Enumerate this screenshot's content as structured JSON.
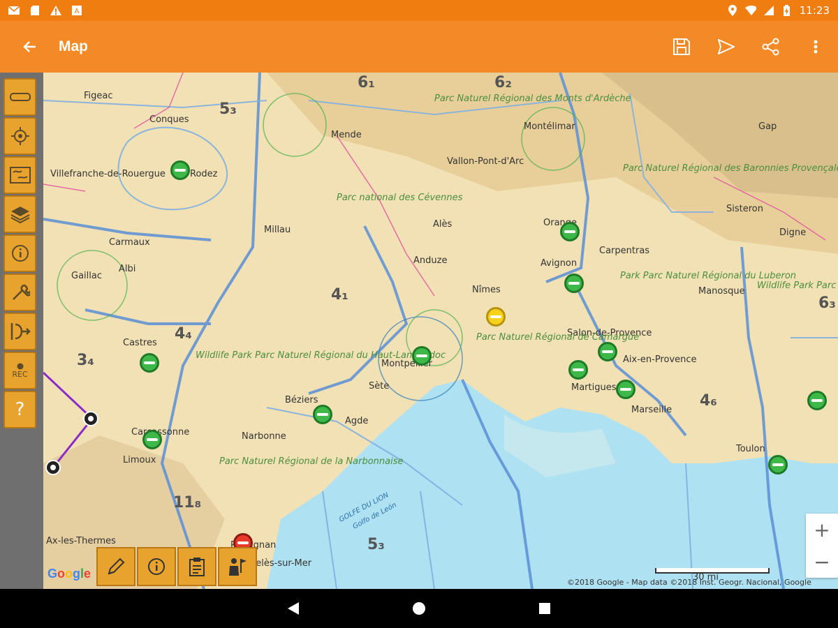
{
  "status": {
    "time": "11:23",
    "icons_left": [
      "email-icon",
      "sim-card-icon",
      "warning-icon",
      "text-icon"
    ],
    "icons_right": [
      "location-icon",
      "wifi-icon",
      "signal-icon",
      "battery-icon"
    ]
  },
  "appbar": {
    "title": "Map",
    "back_icon": "arrow-left-icon",
    "actions": [
      "save-icon",
      "send-icon",
      "share-icon",
      "more-vert-icon"
    ]
  },
  "rail": {
    "items": [
      {
        "name": "ruler-icon"
      },
      {
        "name": "locate-icon"
      },
      {
        "name": "map-layer-icon"
      },
      {
        "name": "layers-icon"
      },
      {
        "name": "info-icon"
      },
      {
        "name": "wrench-icon"
      },
      {
        "name": "route-icon"
      },
      {
        "name": "record-icon",
        "label": "REC"
      },
      {
        "name": "help-icon",
        "label": "?"
      }
    ]
  },
  "map": {
    "cities": [
      "Figeac",
      "Conques",
      "Mende",
      "Montélimar",
      "Gap",
      "Villefranche-de-Rouergue",
      "Rodez",
      "Millau",
      "Alès",
      "Orange",
      "Carpentras",
      "Sisteron",
      "Digne",
      "Carmaux",
      "Albi",
      "Gaillac",
      "Nîmes",
      "Avignon",
      "Manosque",
      "Anduze",
      "Castres",
      "Montpellier",
      "Sète",
      "Salon-de-Provence",
      "Aix-en-Provence",
      "Martigues",
      "Marseille",
      "Béziers",
      "Agde",
      "Carcassonne",
      "Narbonne",
      "Limoux",
      "Toulon",
      "Perpignan",
      "Ax-les-Thermes",
      "Argelès-sur-Mer",
      "Vallon-Pont-d'Arc"
    ],
    "parks": [
      "Parc Naturel Régional des Monts d'Ardèche",
      "Parc national des Cévennes",
      "Parc Naturel Régional des Baronnies Provençales",
      "Park Parc Naturel Régional du Luberon",
      "Wildlife Park Parc Naturel Régional du Verdon",
      "Parc Naturel Régional de Camargue",
      "Wildlife Park Parc Naturel Régional du Haut-Languedoc",
      "Parc Naturel Régional de la Narbonnaise"
    ],
    "sectors": [
      "6₁",
      "6₂",
      "5₃",
      "4₁",
      "4₄",
      "3₄",
      "4₆",
      "11₈",
      "5₃",
      "6₃"
    ],
    "sea": [
      "GOLFE DU LION",
      "Golfo de León"
    ],
    "copyright": "©2018 Google - Map data ©2018 Inst. Geogr. Nacional, Google",
    "scale": "30 mi",
    "google": "Google",
    "zoom_in": "+",
    "zoom_out": "−"
  },
  "bottom_tools": [
    "pencil-icon",
    "info-icon",
    "clipboard-icon",
    "person-flag-icon"
  ],
  "nav": [
    "back-nav-icon",
    "home-nav-icon",
    "recents-nav-icon"
  ]
}
